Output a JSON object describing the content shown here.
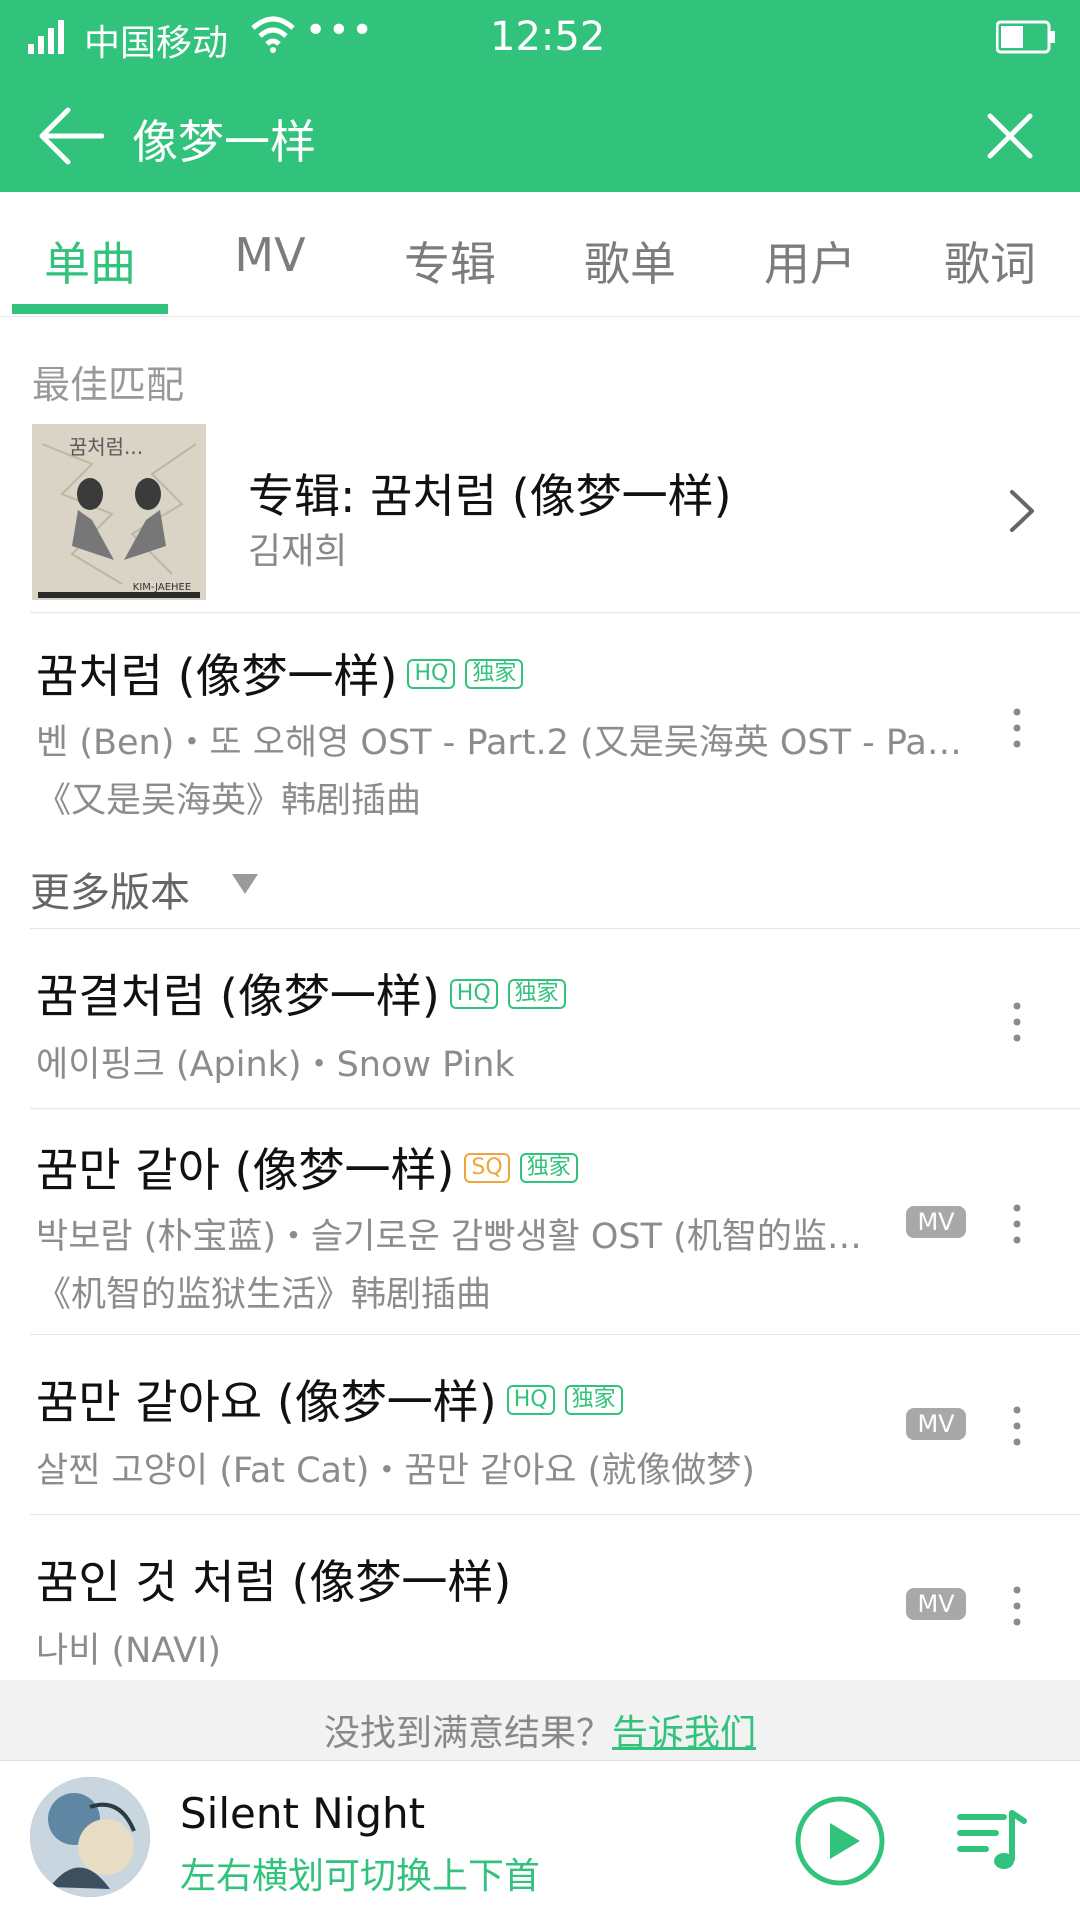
{
  "status_bar": {
    "carrier": "中国移动",
    "dots": "•••",
    "time": "12:52"
  },
  "search": {
    "query": "像梦一样"
  },
  "tabs": [
    {
      "label": "单曲"
    },
    {
      "label": "MV"
    },
    {
      "label": "专辑"
    },
    {
      "label": "歌单"
    },
    {
      "label": "用户"
    },
    {
      "label": "歌词"
    }
  ],
  "best_match": {
    "section_label": "最佳匹配",
    "title": "专辑: 꿈처럼 (像梦一样)",
    "artist": "김재희",
    "cover_text_top": "꿈처럼...",
    "cover_text_bottom": "KIM-JAEHEE"
  },
  "songs": [
    {
      "title": "꿈처럼 (像梦一样)",
      "quality": "HQ",
      "exclusive": "独家",
      "subtitle": "벤 (Ben)・또 오해영 OST - Part.2 (又是吴海英 OST - Pa…",
      "note": "《又是吴海英》韩剧插曲"
    },
    {
      "title": "꿈결처럼 (像梦一样)",
      "quality": "HQ",
      "exclusive": "独家",
      "subtitle": "에이핑크 (Apink)・Snow Pink"
    },
    {
      "title": "꿈만 같아 (像梦一样)",
      "quality": "SQ",
      "exclusive": "独家",
      "subtitle": "박보람 (朴宝蓝)・슬기로운 감빵생활 OST (机智的监…",
      "note": "《机智的监狱生活》韩剧插曲",
      "mv": "MV"
    },
    {
      "title": "꿈만 같아요 (像梦一样)",
      "quality": "HQ",
      "exclusive": "独家",
      "subtitle": "살찐 고양이 (Fat Cat)・꿈만 같아요 (就像做梦)",
      "mv": "MV"
    },
    {
      "title": "꿈인 것 처럼 (像梦一样)",
      "subtitle": "나비 (NAVI)",
      "mv": "MV"
    }
  ],
  "more_versions": "更多版本",
  "feedback": {
    "text": "没找到满意结果？",
    "link": "告诉我们"
  },
  "player": {
    "title": "Silent Night",
    "hint": "左右横划可切换上下首"
  },
  "colors": {
    "accent": "#31c27c",
    "sq": "#f0a43b",
    "mv_badge": "#a8a8a8"
  },
  "icons": [
    "signal-icon",
    "wifi-icon",
    "battery-icon",
    "back-icon",
    "clear-icon",
    "chevron-right-icon",
    "more-vertical-icon",
    "triangle-down-icon",
    "play-icon",
    "playlist-icon"
  ]
}
